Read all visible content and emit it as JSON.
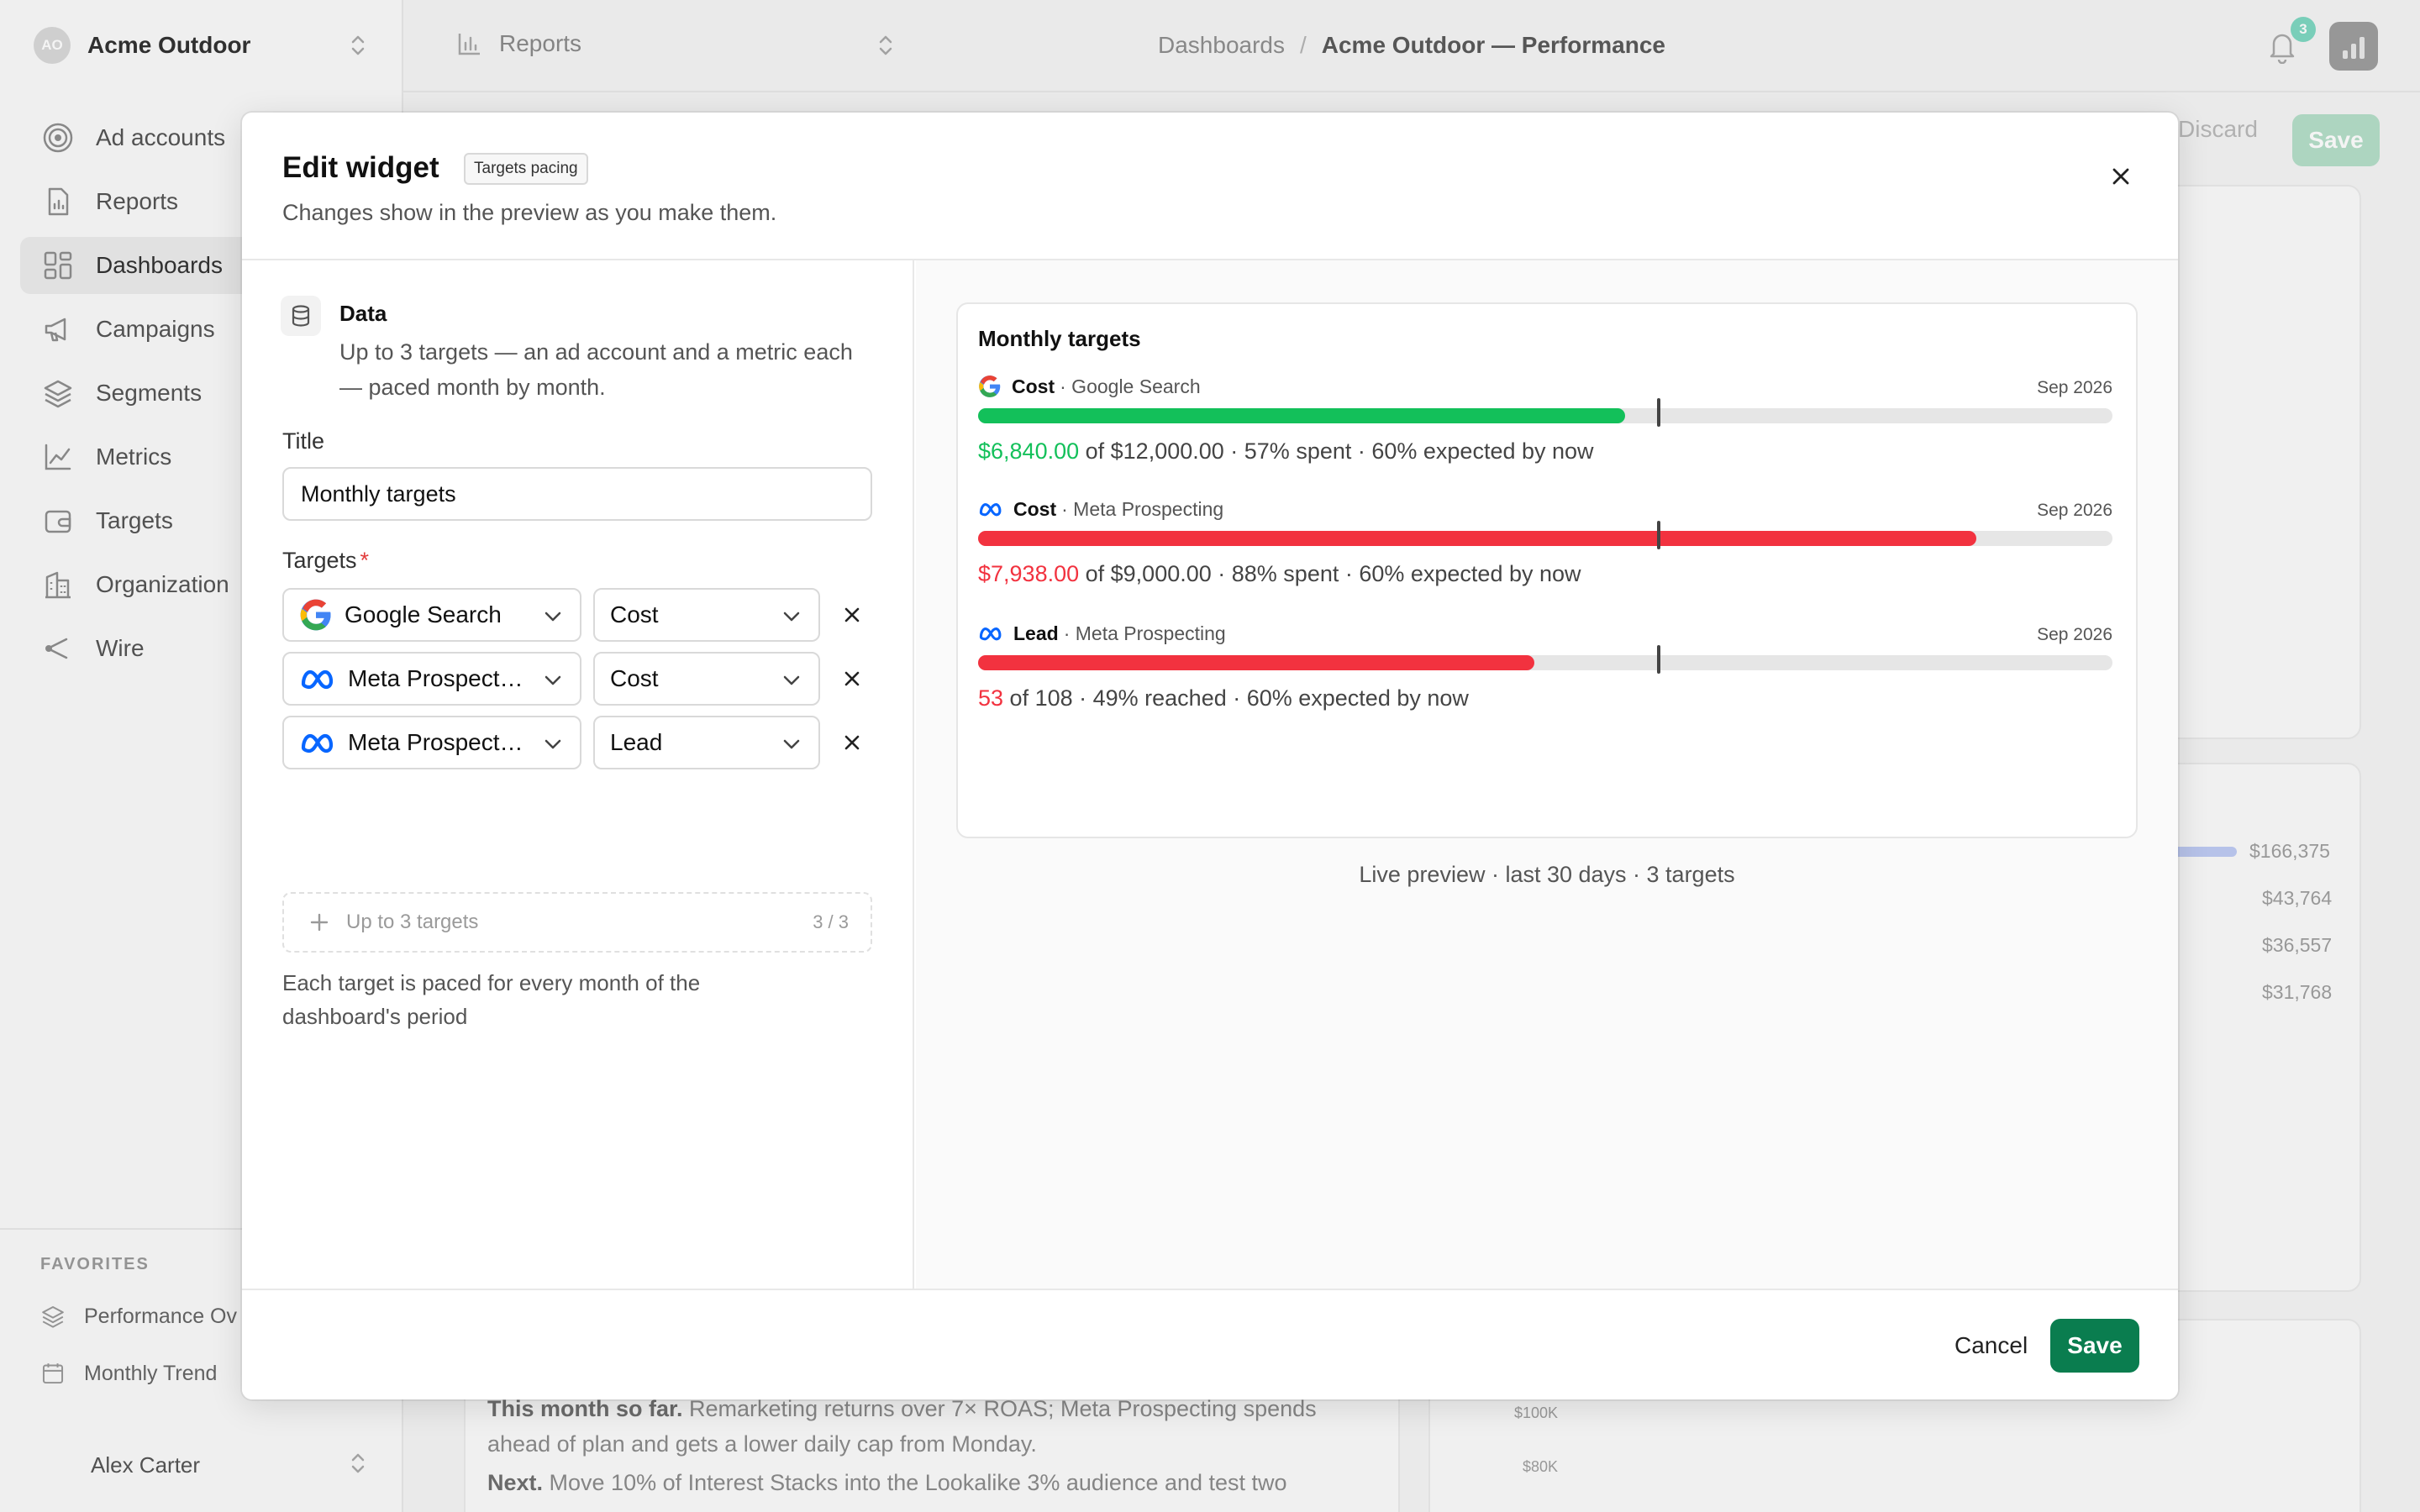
{
  "workspace": {
    "initials": "AO",
    "name": "Acme Outdoor"
  },
  "sidebar": {
    "items": [
      {
        "label": "Ad accounts",
        "icon": "target-icon"
      },
      {
        "label": "Reports",
        "icon": "report-icon"
      },
      {
        "label": "Dashboards",
        "icon": "grid-icon"
      },
      {
        "label": "Campaigns",
        "icon": "megaphone-icon"
      },
      {
        "label": "Segments",
        "icon": "layers-icon"
      },
      {
        "label": "Metrics",
        "icon": "chart-line-icon"
      },
      {
        "label": "Targets",
        "icon": "wallet-icon"
      },
      {
        "label": "Organization",
        "icon": "building-icon"
      },
      {
        "label": "Wire",
        "icon": "share-icon"
      }
    ],
    "favorites_heading": "FAVORITES",
    "favorites": [
      {
        "label": "Performance Ov"
      },
      {
        "label": "Monthly Trend"
      }
    ],
    "user_name": "Alex Carter"
  },
  "topbar": {
    "reports_label": "Reports",
    "breadcrumb_root": "Dashboards",
    "breadcrumb_sep": "/",
    "breadcrumb_current": "Acme Outdoor — Performance",
    "notifications_count": "3"
  },
  "background": {
    "discard_label": "Discard",
    "save_label": "Save",
    "values": [
      "$166,375",
      "$43,764",
      "$36,557",
      "$31,768"
    ],
    "axis": [
      "$100K",
      "$80K"
    ],
    "note_lead1": "This month so far.",
    "note_text1": " Remarketing returns over 7× ROAS; Meta Prospecting spends ahead of plan and gets a lower daily cap from Monday.",
    "note_lead2": "Next.",
    "note_text2": " Move 10% of Interest Stacks into the Lookalike 3% audience and test two"
  },
  "modal": {
    "title": "Edit widget",
    "pill": "Targets pacing",
    "subtitle": "Changes show in the preview as you make them.",
    "data_section": {
      "title": "Data",
      "description": "Up to 3 targets — an ad account and a metric each — paced month by month."
    },
    "title_label": "Title",
    "title_value": "Monthly targets",
    "targets_label": "Targets",
    "required_mark": "*",
    "targets": [
      {
        "account": "Google Search",
        "account_icon": "google-icon",
        "metric": "Cost"
      },
      {
        "account": "Meta Prospecting",
        "account_icon": "meta-icon",
        "metric": "Cost"
      },
      {
        "account": "Meta Prospecting",
        "account_icon": "meta-icon",
        "metric": "Lead"
      }
    ],
    "add_label": "Up to 3 targets",
    "add_count": "3 / 3",
    "hint": "Each target is paced for every month of the dashboard's period",
    "cancel_label": "Cancel",
    "save_label": "Save"
  },
  "preview": {
    "title": "Monthly targets",
    "items": [
      {
        "metric": "Cost",
        "account": "· Google Search",
        "icon": "google-icon",
        "date": "Sep 2026",
        "value": "$6,840.00",
        "rest": " of $12,000.00 · 57% spent · 60% expected by now",
        "progress": 0.57,
        "expected": 0.6,
        "color": "#13c05a"
      },
      {
        "metric": "Cost",
        "account": "· Meta Prospecting",
        "icon": "meta-icon",
        "date": "Sep 2026",
        "value": "$7,938.00",
        "rest": " of $9,000.00 · 88% spent · 60% expected by now",
        "progress": 0.88,
        "expected": 0.6,
        "color": "#f2323f"
      },
      {
        "metric": "Lead",
        "account": "· Meta Prospecting",
        "icon": "meta-icon",
        "date": "Sep 2026",
        "value": "53",
        "rest": " of 108 · 49% reached · 60% expected by now",
        "progress": 0.49,
        "expected": 0.6,
        "color": "#f2323f"
      }
    ],
    "caption": "Live preview · last 30 days · 3 targets"
  }
}
